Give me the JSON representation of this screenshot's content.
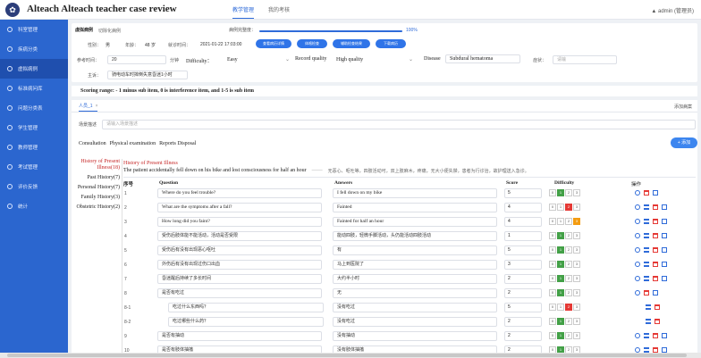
{
  "header": {
    "title": "Alteach Alteach teacher case review",
    "nav": [
      "教学管理",
      "我的考核"
    ],
    "active_nav": 0,
    "user": "admin (管理员)"
  },
  "sidebar": {
    "items": [
      "科室管理",
      "疾病分类",
      "虚拟病例",
      "标准病问库",
      "问题分类表",
      "学生管理",
      "教师管理",
      "考试管理",
      "评价反馈",
      "统计"
    ],
    "active": 2
  },
  "case_info": {
    "case_name_label": "虚拟病例",
    "case_name": "切除化病例",
    "progress_label": "病例完整度：",
    "progress_percent": 100,
    "progress_text": "100%",
    "gender_label": "性别：",
    "gender": "男",
    "age_label": "年龄：",
    "age": "48 岁",
    "time_label": "就诊时间：",
    "time": "2021-01-22 17:03:00",
    "buttons": [
      "查看病历详情",
      "体格检查",
      "辅助检查结果",
      "下载病历"
    ],
    "ref_time_label": "参考时间：",
    "ref_time": "20",
    "minutes_label": "分钟",
    "difficulty_label": "Difficulty：",
    "difficulty": "Easy",
    "record_quality_label": "Record quality",
    "record_quality": "High quality",
    "disease_label": "Disease",
    "disease": "Subdural hematoma",
    "symptom_label": "症状：",
    "symptom_placeholder": "请输",
    "complaint_label": "主诉：",
    "complaint": "骑电动车时摔倒失意昏迷1小时"
  },
  "scoring_note": "Scoring range: - 1 minus sub item, 0 is interference item, and 1-5 is sub item",
  "workspace": {
    "tab": "人员_1",
    "add_label": "添加病案",
    "scene_label": "场景描述",
    "scene_placeholder": "请输入场景描述",
    "subtabs": [
      "Consultation",
      "Physical examination",
      "Reports Disposal"
    ],
    "add_button": "+ 添加",
    "histories": [
      "History of Present Illness(18)",
      "Past History(7)",
      "Personal History(7)",
      "Family History(3)",
      "Obstetric History(2)"
    ],
    "active_history": 0,
    "hpi_title": "History of Present Illness",
    "hpi_text": "The patient accidentally fell down on his bike and lost consciousness for half an hour",
    "hpi_text_cn": "无恶心、呕吐等，四肢活动可，双上肢麻木，疼痛，无大小便失禁，患者为行诊治，故护理送入急诊。",
    "headers": {
      "num": "序号",
      "question": "Question",
      "answers": "Answers",
      "score": "Score",
      "difficulty": "Difficulty",
      "ops": "操作"
    }
  },
  "rows": [
    {
      "num": "1",
      "question": "Where do you feel trouble?",
      "answer": "I fell down on my bike",
      "score": "5",
      "difficulty": 2,
      "en": true,
      "ops": [
        "add",
        "del",
        "edit"
      ]
    },
    {
      "num": "2",
      "question": "What are the symptoms after a fall?",
      "answer": "Fainted",
      "score": "4",
      "difficulty": 3,
      "en": true,
      "ops": [
        "add",
        "list",
        "del",
        "edit"
      ]
    },
    {
      "num": "3",
      "question": "How long did you faint?",
      "answer": "Fainted for half an hour",
      "score": "4",
      "difficulty": 4,
      "en": true,
      "ops": [
        "add",
        "list",
        "del",
        "edit"
      ]
    },
    {
      "num": "4",
      "question": "受伤后肢体能不能活动，活动是否受限",
      "answer": "能动四肢，轻微手脚活动，头仍能活动四肢活动",
      "score": "1",
      "difficulty": 2,
      "en": false,
      "ops": [
        "add",
        "list",
        "del",
        "edit"
      ]
    },
    {
      "num": "5",
      "question": "受伤后有没有出现恶心呕吐",
      "answer": "有",
      "score": "5",
      "difficulty": 2,
      "en": false,
      "ops": [
        "add",
        "list",
        "del",
        "edit"
      ]
    },
    {
      "num": "6",
      "question": "外伤后有没有出现过伤口出血",
      "answer": "马上到医院了",
      "score": "3",
      "difficulty": 2,
      "en": false,
      "ops": [
        "add",
        "list",
        "del",
        "edit"
      ]
    },
    {
      "num": "7",
      "question": "昏迷醒后持续了多长时间",
      "answer": "大约半小时",
      "score": "2",
      "difficulty": 2,
      "en": false,
      "ops": [
        "add",
        "list",
        "del",
        "edit"
      ]
    },
    {
      "num": "8",
      "question": "是否有吃过",
      "answer": "无",
      "score": "2",
      "difficulty": 2,
      "en": false,
      "ops": [
        "add",
        "del",
        "edit"
      ]
    },
    {
      "num": "8-1",
      "question": "吃过什么东西吗？",
      "answer": "没有吃过",
      "score": "5",
      "difficulty": 3,
      "en": false,
      "sub": true,
      "ops": [
        "list",
        "del"
      ]
    },
    {
      "num": "8-2",
      "question": "吃过哪些什么药？",
      "answer": "没有吃过",
      "score": "2",
      "difficulty": 2,
      "en": false,
      "sub": true,
      "ops": [
        "list",
        "del"
      ]
    },
    {
      "num": "9",
      "question": "是否有抽动",
      "answer": "没有抽动",
      "score": "2",
      "difficulty": 2,
      "en": false,
      "ops": [
        "add",
        "list",
        "del",
        "edit"
      ]
    },
    {
      "num": "10",
      "question": "是否有肢体抽搐",
      "answer": "没有肢体抽搐",
      "score": "2",
      "difficulty": 2,
      "en": false,
      "ops": [
        "add",
        "list",
        "del",
        "edit"
      ]
    }
  ],
  "colors": {
    "primary": "#2f6bd9",
    "sidebar": "#2b66cf",
    "active_green": "#43a047",
    "active_red": "#e53935",
    "active_orange": "#f39c12"
  }
}
